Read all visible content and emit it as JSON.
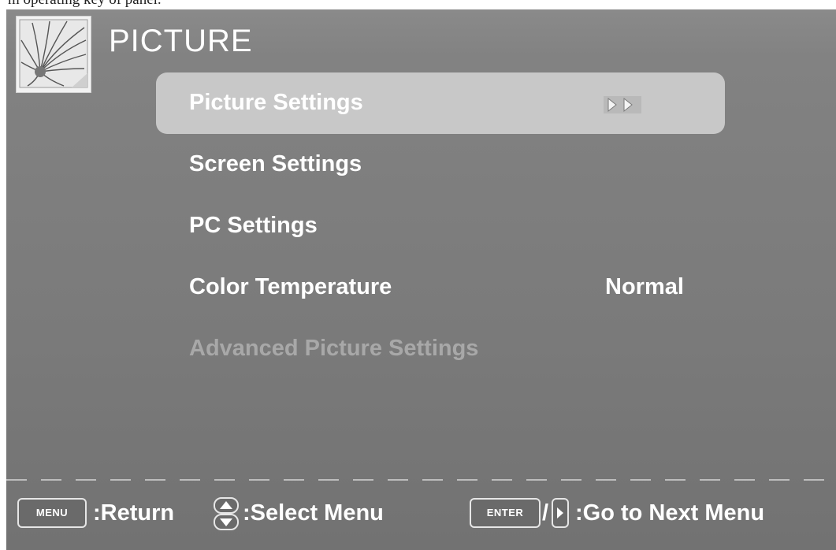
{
  "caption_fragment": "m operating key of panel.",
  "header": {
    "logo_icon": "flower-logo-icon",
    "title": "PICTURE"
  },
  "menu": {
    "items": [
      {
        "label": "Picture Settings",
        "value": "",
        "state": "selected",
        "submenu_icon": "double-arrow-right-icon"
      },
      {
        "label": "Screen Settings",
        "value": "",
        "state": "normal"
      },
      {
        "label": "PC Settings",
        "value": "",
        "state": "normal"
      },
      {
        "label": "Color Temperature",
        "value": "Normal",
        "state": "normal"
      },
      {
        "label": "Advanced Picture Settings",
        "value": "",
        "state": "disabled"
      }
    ]
  },
  "help_bar": {
    "menu_key": "MENU",
    "return_text": ":Return",
    "select_icon": "up-down-icon",
    "select_text": ":Select Menu",
    "enter_key": "ENTER",
    "slash": "/",
    "right_icon": "arrow-right-key-icon",
    "next_text": ":Go to Next Menu"
  },
  "colors": {
    "background": "#7e7e7e",
    "selected_highlight": "#c8c8c8",
    "text": "#ffffff",
    "disabled_text": "#a8a8a8"
  }
}
